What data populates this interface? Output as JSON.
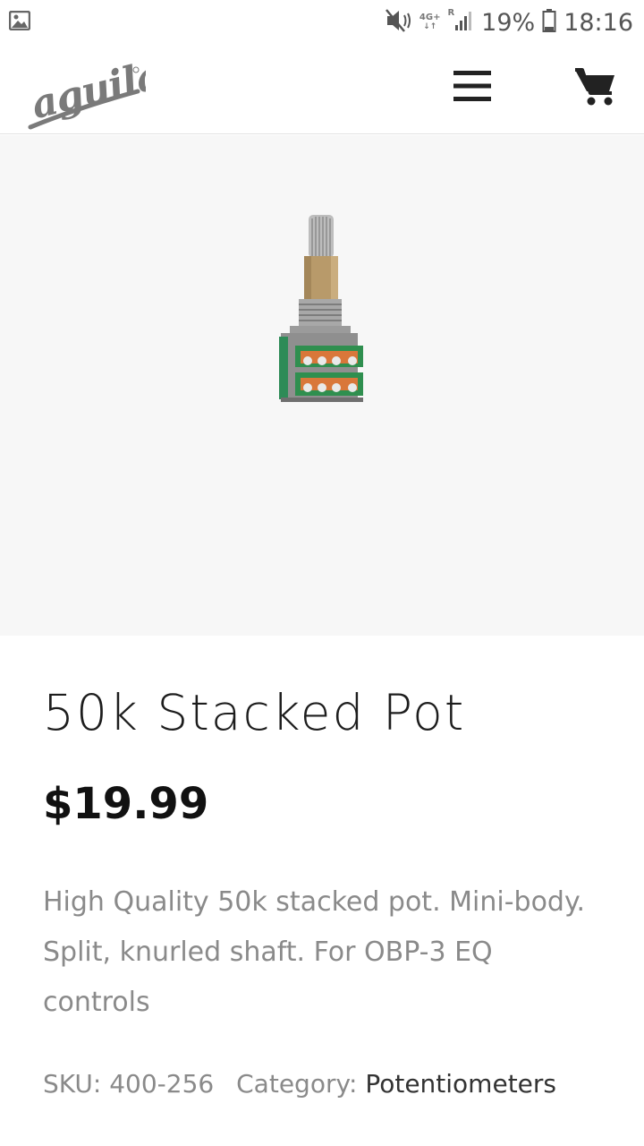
{
  "status_bar": {
    "network": "4G+",
    "roaming": "R",
    "battery": "19%",
    "time": "18:16"
  },
  "header": {
    "logo_text": "aguilar",
    "menu_icon": "hamburger-menu-icon",
    "cart_icon": "shopping-cart-icon"
  },
  "product": {
    "title": "50k Stacked Pot",
    "price": "$19.99",
    "description": "High Quality 50k stacked pot. Mini-body. Split, knurled shaft. For OBP-3 EQ controls",
    "sku_label": "SKU:",
    "sku_value": "400-256",
    "category_label": "Category:",
    "category_value": "Potentiometers"
  },
  "colors": {
    "gallery_bg": "#f7f7f7",
    "text_muted": "#8a8a8a",
    "text_dark": "#1d1d1d"
  }
}
